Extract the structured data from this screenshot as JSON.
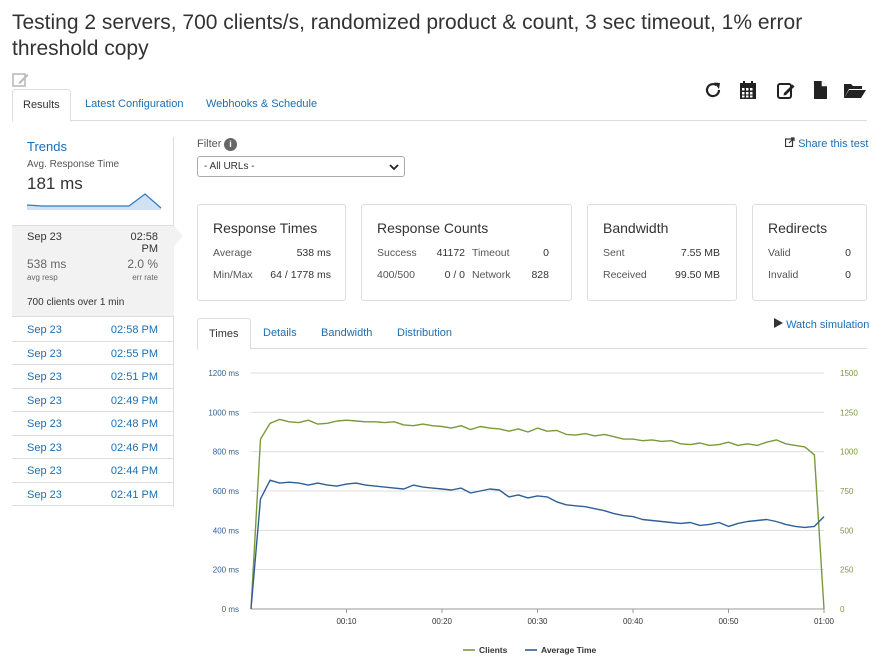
{
  "page": {
    "title": "Testing 2 servers, 700 clients/s, randomized product & count, 3 sec timeout, 1% error threshold copy"
  },
  "tabs": {
    "results": "Results",
    "latest_config": "Latest Configuration",
    "webhooks": "Webhooks & Schedule"
  },
  "toolbar_icons": [
    "refresh-icon",
    "calendar-icon",
    "edit-icon",
    "document-icon",
    "folder-open-icon"
  ],
  "sidebar": {
    "trends_title": "Trends",
    "avg_label": "Avg. Response Time",
    "avg_value": "181 ms",
    "selected": {
      "date": "Sep 23",
      "time": "02:58 PM",
      "resp": "538 ms",
      "resp_label": "avg resp",
      "err": "2.0 %",
      "err_label": "err rate",
      "clients": "700",
      "clients_suffix": "clients over",
      "duration": "1",
      "duration_suffix": "min"
    },
    "history": [
      {
        "date": "Sep 23",
        "time": "02:58 PM"
      },
      {
        "date": "Sep 23",
        "time": "02:55 PM"
      },
      {
        "date": "Sep 23",
        "time": "02:51 PM"
      },
      {
        "date": "Sep 23",
        "time": "02:49 PM"
      },
      {
        "date": "Sep 23",
        "time": "02:48 PM"
      },
      {
        "date": "Sep 23",
        "time": "02:46 PM"
      },
      {
        "date": "Sep 23",
        "time": "02:44 PM"
      },
      {
        "date": "Sep 23",
        "time": "02:41 PM"
      }
    ]
  },
  "filter": {
    "label": "Filter",
    "info": "i",
    "selected": "- All URLs -"
  },
  "share_label": "Share this test",
  "cards": {
    "response_times": {
      "title": "Response Times",
      "average_label": "Average",
      "average": "538 ms",
      "minmax_label": "Min/Max",
      "minmax": "64 / 1778 ms"
    },
    "response_counts": {
      "title": "Response Counts",
      "success_label": "Success",
      "success": "41172",
      "timeout_label": "Timeout",
      "timeout": "0",
      "r400_label": "400/500",
      "r400": "0 / 0",
      "network_label": "Network",
      "network": "828"
    },
    "bandwidth": {
      "title": "Bandwidth",
      "sent_label": "Sent",
      "sent": "7.55 MB",
      "received_label": "Received",
      "received": "99.50 MB"
    },
    "redirects": {
      "title": "Redirects",
      "valid_label": "Valid",
      "valid": "0",
      "invalid_label": "Invalid",
      "invalid": "0"
    }
  },
  "chart_tabs": {
    "times": "Times",
    "details": "Details",
    "bandwidth": "Bandwidth",
    "distribution": "Distribution"
  },
  "watch_label": "Watch simulation",
  "colors": {
    "link": "#1a6fb5",
    "clients": "#7a9a3a",
    "avg_time": "#2f5f95"
  },
  "chart_data": {
    "type": "line",
    "x": [
      0,
      1,
      2,
      3,
      4,
      5,
      6,
      7,
      8,
      9,
      10,
      11,
      12,
      13,
      14,
      15,
      16,
      17,
      18,
      19,
      20,
      21,
      22,
      23,
      24,
      25,
      26,
      27,
      28,
      29,
      30,
      31,
      32,
      33,
      34,
      35,
      36,
      37,
      38,
      39,
      40,
      41,
      42,
      43,
      44,
      45,
      46,
      47,
      48,
      49,
      50,
      51,
      52,
      53,
      54,
      55,
      56,
      57,
      58,
      59,
      60
    ],
    "xticks": [
      "00:10",
      "00:20",
      "00:30",
      "00:40",
      "00:50",
      "01:00"
    ],
    "xtick_values": [
      10,
      20,
      30,
      40,
      50,
      60
    ],
    "y_left_ticks": [
      "0 ms",
      "200 ms",
      "400 ms",
      "600 ms",
      "800 ms",
      "1000 ms",
      "1200 ms"
    ],
    "y_left_range": [
      0,
      1200
    ],
    "y_right_ticks": [
      "0",
      "250",
      "500",
      "750",
      "1000",
      "1250",
      "1500"
    ],
    "y_right_range": [
      0,
      1500
    ],
    "series": [
      {
        "name": "Clients",
        "axis": "right",
        "values": [
          0,
          1080,
          1180,
          1205,
          1190,
          1185,
          1200,
          1175,
          1180,
          1195,
          1200,
          1195,
          1190,
          1190,
          1185,
          1190,
          1170,
          1165,
          1175,
          1165,
          1160,
          1150,
          1165,
          1140,
          1160,
          1150,
          1145,
          1130,
          1145,
          1125,
          1150,
          1130,
          1135,
          1110,
          1105,
          1115,
          1100,
          1110,
          1095,
          1080,
          1080,
          1070,
          1075,
          1065,
          1070,
          1050,
          1045,
          1055,
          1040,
          1045,
          1060,
          1040,
          1050,
          1040,
          1060,
          1075,
          1050,
          1040,
          1030,
          980,
          0
        ]
      },
      {
        "name": "Average Time",
        "axis": "left",
        "values": [
          0,
          560,
          655,
          640,
          645,
          640,
          630,
          640,
          630,
          625,
          635,
          640,
          630,
          625,
          620,
          615,
          610,
          630,
          620,
          615,
          610,
          605,
          615,
          590,
          600,
          610,
          605,
          570,
          580,
          565,
          575,
          570,
          545,
          530,
          525,
          520,
          510,
          500,
          485,
          475,
          470,
          455,
          450,
          445,
          440,
          435,
          440,
          425,
          430,
          440,
          420,
          435,
          445,
          450,
          455,
          445,
          430,
          420,
          415,
          420,
          470
        ]
      }
    ]
  }
}
